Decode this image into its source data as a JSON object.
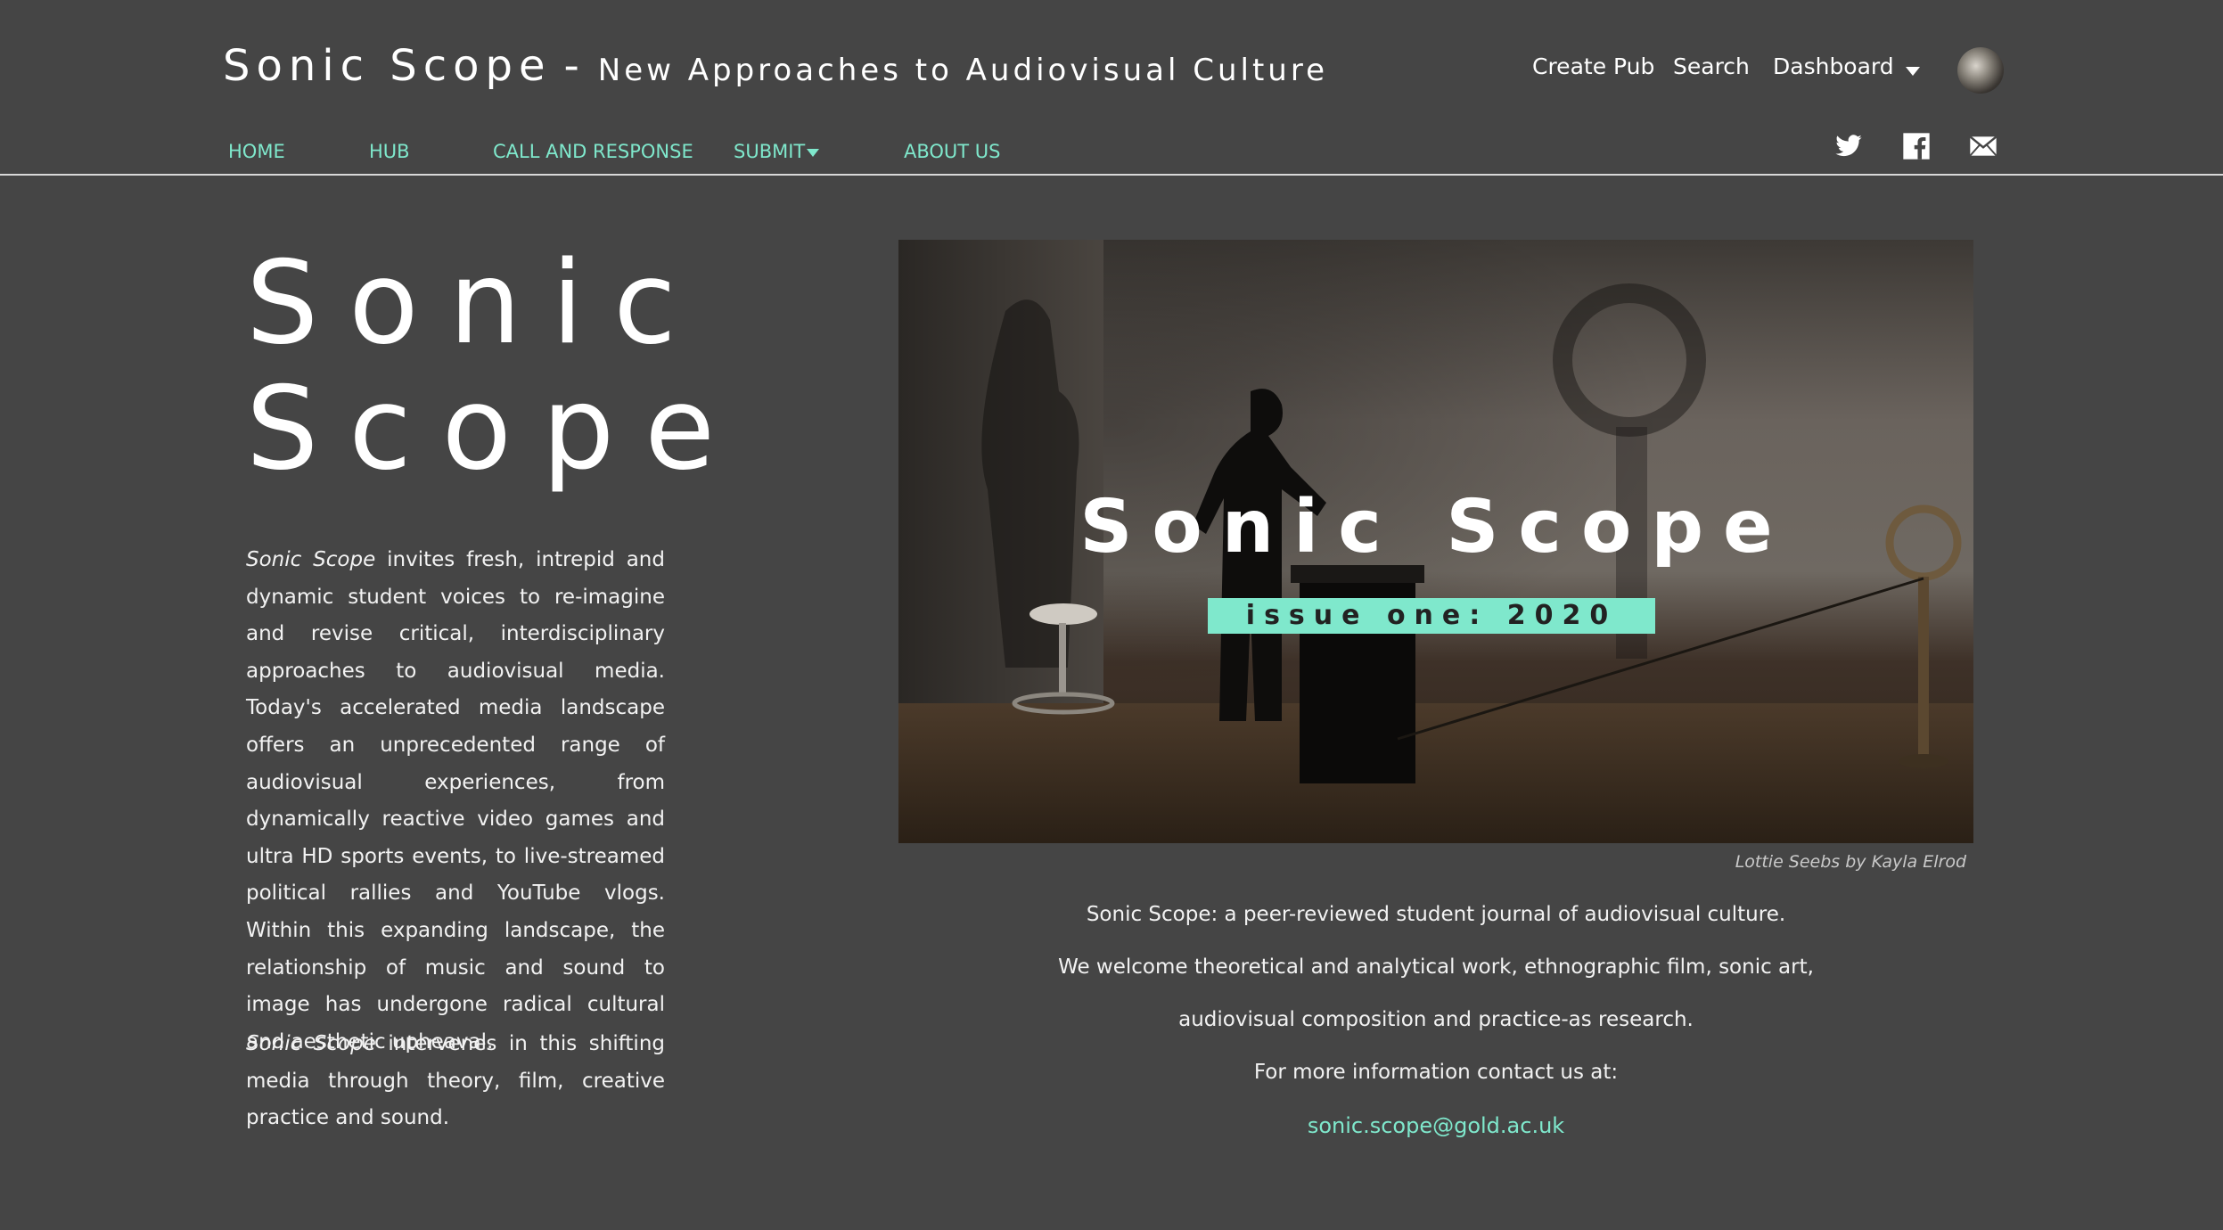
{
  "header": {
    "site_name": "Sonic Scope",
    "separator": "-",
    "tagline": "New Approaches to Audiovisual Culture",
    "create_pub": "Create Pub",
    "search": "Search",
    "dashboard": "Dashboard"
  },
  "menu": {
    "home": "HOME",
    "hub": "HUB",
    "call_and_response": "CALL AND RESPONSE",
    "submit": "SUBMIT",
    "about_us": "ABOUT US"
  },
  "social": [
    "twitter-icon",
    "facebook-icon",
    "mail-icon"
  ],
  "logo": {
    "line1": "Sonic",
    "line2": "Scope"
  },
  "intro": {
    "p1_italic": "Sonic Scope",
    "p1_rest": " invites fresh, intrepid and dynamic student voices to re-imagine and revise critical, interdisciplinary approaches to audiovisual media. Today's accelerated media landscape offers an unprecedented range of audiovisual experiences, from dynamically reactive video games and ultra HD sports events, to live-streamed political rallies and YouTube vlogs. Within this expanding landscape, the relationship of music and sound to image has undergone radical cultural and aesthetic upheaval.",
    "p2_italic": "Sonic Scope",
    "p2_rest": " intervenes in this shifting media through theory, film, creative practice and sound."
  },
  "hero": {
    "title": "Sonic Scope",
    "badge": "issue one: 2020",
    "caption": "Lottie Seebs by Kayla Elrod"
  },
  "info": {
    "line1": "Sonic Scope: a peer-reviewed student journal of audiovisual culture.",
    "line2": "We welcome theoretical and analytical work, ethnographic film, sonic art,",
    "line3": "audiovisual composition and practice-as research.",
    "line4": "For more information contact us at:",
    "email": "sonic.scope@gold.ac.uk"
  },
  "colors": {
    "background": "#454545",
    "accent": "#7fe8cc",
    "text": "#ffffff"
  }
}
